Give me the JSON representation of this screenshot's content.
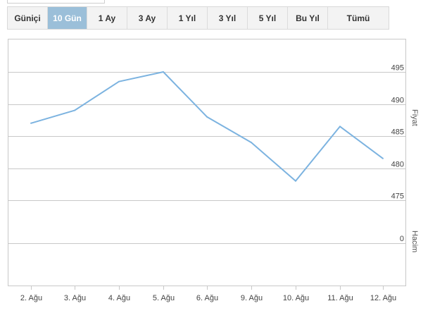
{
  "range_buttons": [
    {
      "label": "Güniçi",
      "active": false
    },
    {
      "label": "10 Gün",
      "active": true
    },
    {
      "label": "1 Ay",
      "active": false
    },
    {
      "label": "3 Ay",
      "active": false
    },
    {
      "label": "1 Yıl",
      "active": false
    },
    {
      "label": "3 Yıl",
      "active": false
    },
    {
      "label": "5 Yıl",
      "active": false
    },
    {
      "label": "Bu Yıl",
      "active": false
    },
    {
      "label": "Tümü",
      "active": false
    }
  ],
  "colors": {
    "line": "#7cb3e0",
    "active_button": "#9bbfd9",
    "grid": "#c8c8c8"
  },
  "chart_data": {
    "type": "line",
    "categories": [
      "2. Ağu",
      "3. Ağu",
      "4. Ağu",
      "5. Ağu",
      "6. Ağu",
      "9. Ağu",
      "10. Ağu",
      "11. Ağu",
      "12. Ağu"
    ],
    "series": [
      {
        "values": [
          487.0,
          489.0,
          493.5,
          495.0,
          488.0,
          484.0,
          478.0,
          486.5,
          481.5
        ]
      }
    ],
    "price_ticks": [
      475,
      480,
      485,
      490,
      495
    ],
    "ylim": [
      475,
      495
    ],
    "volume_ticks": [
      0
    ],
    "ylabel_price": "Fiyat",
    "ylabel_volume": "Hacim",
    "grid": true
  }
}
